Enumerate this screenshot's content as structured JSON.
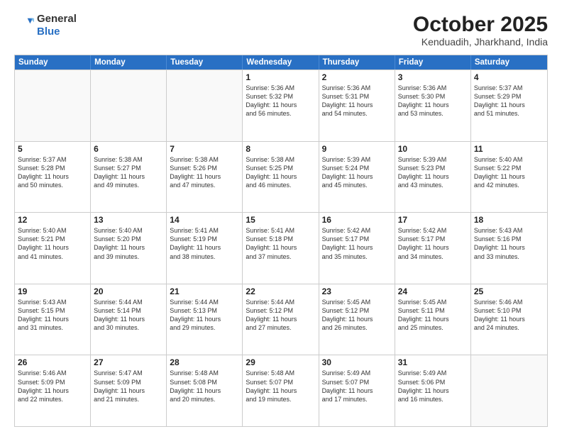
{
  "header": {
    "logo_general": "General",
    "logo_blue": "Blue",
    "month_title": "October 2025",
    "location": "Kenduadih, Jharkhand, India"
  },
  "weekdays": [
    "Sunday",
    "Monday",
    "Tuesday",
    "Wednesday",
    "Thursday",
    "Friday",
    "Saturday"
  ],
  "weeks": [
    [
      {
        "day": "",
        "info": "",
        "empty": true
      },
      {
        "day": "",
        "info": "",
        "empty": true
      },
      {
        "day": "",
        "info": "",
        "empty": true
      },
      {
        "day": "1",
        "info": "Sunrise: 5:36 AM\nSunset: 5:32 PM\nDaylight: 11 hours\nand 56 minutes.",
        "empty": false
      },
      {
        "day": "2",
        "info": "Sunrise: 5:36 AM\nSunset: 5:31 PM\nDaylight: 11 hours\nand 54 minutes.",
        "empty": false
      },
      {
        "day": "3",
        "info": "Sunrise: 5:36 AM\nSunset: 5:30 PM\nDaylight: 11 hours\nand 53 minutes.",
        "empty": false
      },
      {
        "day": "4",
        "info": "Sunrise: 5:37 AM\nSunset: 5:29 PM\nDaylight: 11 hours\nand 51 minutes.",
        "empty": false
      }
    ],
    [
      {
        "day": "5",
        "info": "Sunrise: 5:37 AM\nSunset: 5:28 PM\nDaylight: 11 hours\nand 50 minutes.",
        "empty": false
      },
      {
        "day": "6",
        "info": "Sunrise: 5:38 AM\nSunset: 5:27 PM\nDaylight: 11 hours\nand 49 minutes.",
        "empty": false
      },
      {
        "day": "7",
        "info": "Sunrise: 5:38 AM\nSunset: 5:26 PM\nDaylight: 11 hours\nand 47 minutes.",
        "empty": false
      },
      {
        "day": "8",
        "info": "Sunrise: 5:38 AM\nSunset: 5:25 PM\nDaylight: 11 hours\nand 46 minutes.",
        "empty": false
      },
      {
        "day": "9",
        "info": "Sunrise: 5:39 AM\nSunset: 5:24 PM\nDaylight: 11 hours\nand 45 minutes.",
        "empty": false
      },
      {
        "day": "10",
        "info": "Sunrise: 5:39 AM\nSunset: 5:23 PM\nDaylight: 11 hours\nand 43 minutes.",
        "empty": false
      },
      {
        "day": "11",
        "info": "Sunrise: 5:40 AM\nSunset: 5:22 PM\nDaylight: 11 hours\nand 42 minutes.",
        "empty": false
      }
    ],
    [
      {
        "day": "12",
        "info": "Sunrise: 5:40 AM\nSunset: 5:21 PM\nDaylight: 11 hours\nand 41 minutes.",
        "empty": false
      },
      {
        "day": "13",
        "info": "Sunrise: 5:40 AM\nSunset: 5:20 PM\nDaylight: 11 hours\nand 39 minutes.",
        "empty": false
      },
      {
        "day": "14",
        "info": "Sunrise: 5:41 AM\nSunset: 5:19 PM\nDaylight: 11 hours\nand 38 minutes.",
        "empty": false
      },
      {
        "day": "15",
        "info": "Sunrise: 5:41 AM\nSunset: 5:18 PM\nDaylight: 11 hours\nand 37 minutes.",
        "empty": false
      },
      {
        "day": "16",
        "info": "Sunrise: 5:42 AM\nSunset: 5:17 PM\nDaylight: 11 hours\nand 35 minutes.",
        "empty": false
      },
      {
        "day": "17",
        "info": "Sunrise: 5:42 AM\nSunset: 5:17 PM\nDaylight: 11 hours\nand 34 minutes.",
        "empty": false
      },
      {
        "day": "18",
        "info": "Sunrise: 5:43 AM\nSunset: 5:16 PM\nDaylight: 11 hours\nand 33 minutes.",
        "empty": false
      }
    ],
    [
      {
        "day": "19",
        "info": "Sunrise: 5:43 AM\nSunset: 5:15 PM\nDaylight: 11 hours\nand 31 minutes.",
        "empty": false
      },
      {
        "day": "20",
        "info": "Sunrise: 5:44 AM\nSunset: 5:14 PM\nDaylight: 11 hours\nand 30 minutes.",
        "empty": false
      },
      {
        "day": "21",
        "info": "Sunrise: 5:44 AM\nSunset: 5:13 PM\nDaylight: 11 hours\nand 29 minutes.",
        "empty": false
      },
      {
        "day": "22",
        "info": "Sunrise: 5:44 AM\nSunset: 5:12 PM\nDaylight: 11 hours\nand 27 minutes.",
        "empty": false
      },
      {
        "day": "23",
        "info": "Sunrise: 5:45 AM\nSunset: 5:12 PM\nDaylight: 11 hours\nand 26 minutes.",
        "empty": false
      },
      {
        "day": "24",
        "info": "Sunrise: 5:45 AM\nSunset: 5:11 PM\nDaylight: 11 hours\nand 25 minutes.",
        "empty": false
      },
      {
        "day": "25",
        "info": "Sunrise: 5:46 AM\nSunset: 5:10 PM\nDaylight: 11 hours\nand 24 minutes.",
        "empty": false
      }
    ],
    [
      {
        "day": "26",
        "info": "Sunrise: 5:46 AM\nSunset: 5:09 PM\nDaylight: 11 hours\nand 22 minutes.",
        "empty": false
      },
      {
        "day": "27",
        "info": "Sunrise: 5:47 AM\nSunset: 5:09 PM\nDaylight: 11 hours\nand 21 minutes.",
        "empty": false
      },
      {
        "day": "28",
        "info": "Sunrise: 5:48 AM\nSunset: 5:08 PM\nDaylight: 11 hours\nand 20 minutes.",
        "empty": false
      },
      {
        "day": "29",
        "info": "Sunrise: 5:48 AM\nSunset: 5:07 PM\nDaylight: 11 hours\nand 19 minutes.",
        "empty": false
      },
      {
        "day": "30",
        "info": "Sunrise: 5:49 AM\nSunset: 5:07 PM\nDaylight: 11 hours\nand 17 minutes.",
        "empty": false
      },
      {
        "day": "31",
        "info": "Sunrise: 5:49 AM\nSunset: 5:06 PM\nDaylight: 11 hours\nand 16 minutes.",
        "empty": false
      },
      {
        "day": "",
        "info": "",
        "empty": true
      }
    ]
  ]
}
